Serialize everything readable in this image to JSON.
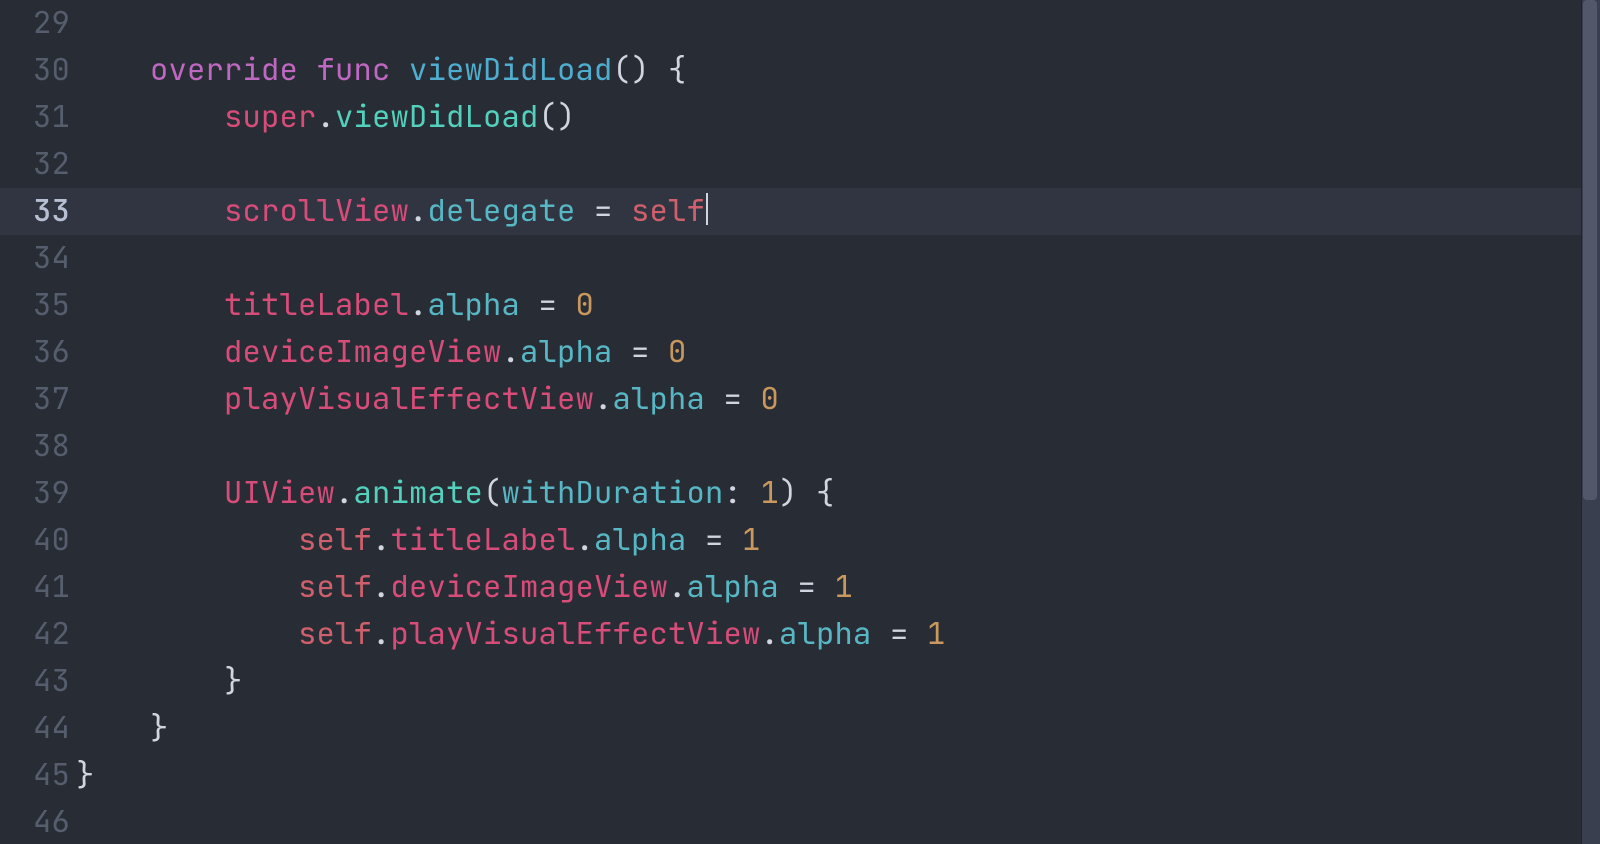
{
  "colors": {
    "bg": "#282c34",
    "keyword": "#bf68c1",
    "identifier": "#d84c7a",
    "func": "#4faecf",
    "call": "#53d1bd",
    "prop": "#58b7c4",
    "self": "#ce5f6c",
    "num": "#c8985e",
    "punct": "#d1d5e0",
    "gutter": "#565e6e",
    "gutter_active": "#b7c0d2",
    "active_line": "#303541",
    "scrollbar": "#52586a",
    "scrollbar_track": "#393f4e"
  },
  "editor": {
    "language": "swift",
    "active_line": 33,
    "cursor_line": 33,
    "first_visible_line": 29,
    "last_visible_line": 46,
    "line_numbers": [
      "29",
      "30",
      "31",
      "32",
      "33",
      "34",
      "35",
      "36",
      "37",
      "38",
      "39",
      "40",
      "41",
      "42",
      "43",
      "44",
      "45",
      "46"
    ],
    "lines": [
      {
        "n": 29,
        "indent": 0,
        "tokens": []
      },
      {
        "n": 30,
        "indent": 4,
        "tokens": [
          {
            "cls": "kw",
            "t": "override"
          },
          {
            "cls": "pt",
            "t": " "
          },
          {
            "cls": "kw",
            "t": "func"
          },
          {
            "cls": "pt",
            "t": " "
          },
          {
            "cls": "fn",
            "t": "viewDidLoad"
          },
          {
            "cls": "pt",
            "t": "() {"
          }
        ]
      },
      {
        "n": 31,
        "indent": 8,
        "tokens": [
          {
            "cls": "id",
            "t": "super"
          },
          {
            "cls": "pt",
            "t": "."
          },
          {
            "cls": "cl",
            "t": "viewDidLoad"
          },
          {
            "cls": "pt",
            "t": "()"
          }
        ]
      },
      {
        "n": 32,
        "indent": 0,
        "tokens": []
      },
      {
        "n": 33,
        "indent": 8,
        "tokens": [
          {
            "cls": "id",
            "t": "scrollView"
          },
          {
            "cls": "pt",
            "t": "."
          },
          {
            "cls": "pr",
            "t": "delegate"
          },
          {
            "cls": "pt",
            "t": " = "
          },
          {
            "cls": "sf",
            "t": "self"
          }
        ],
        "cursor_after": true
      },
      {
        "n": 34,
        "indent": 0,
        "tokens": []
      },
      {
        "n": 35,
        "indent": 8,
        "tokens": [
          {
            "cls": "id",
            "t": "titleLabel"
          },
          {
            "cls": "pt",
            "t": "."
          },
          {
            "cls": "pr",
            "t": "alpha"
          },
          {
            "cls": "pt",
            "t": " = "
          },
          {
            "cls": "nm",
            "t": "0"
          }
        ]
      },
      {
        "n": 36,
        "indent": 8,
        "tokens": [
          {
            "cls": "id",
            "t": "deviceImageView"
          },
          {
            "cls": "pt",
            "t": "."
          },
          {
            "cls": "pr",
            "t": "alpha"
          },
          {
            "cls": "pt",
            "t": " = "
          },
          {
            "cls": "nm",
            "t": "0"
          }
        ]
      },
      {
        "n": 37,
        "indent": 8,
        "tokens": [
          {
            "cls": "id",
            "t": "playVisualEffectView"
          },
          {
            "cls": "pt",
            "t": "."
          },
          {
            "cls": "pr",
            "t": "alpha"
          },
          {
            "cls": "pt",
            "t": " = "
          },
          {
            "cls": "nm",
            "t": "0"
          }
        ]
      },
      {
        "n": 38,
        "indent": 0,
        "tokens": []
      },
      {
        "n": 39,
        "indent": 8,
        "tokens": [
          {
            "cls": "id",
            "t": "UIView"
          },
          {
            "cls": "pt",
            "t": "."
          },
          {
            "cls": "cl",
            "t": "animate"
          },
          {
            "cls": "pt",
            "t": "("
          },
          {
            "cls": "pr",
            "t": "withDuration"
          },
          {
            "cls": "pt",
            "t": ": "
          },
          {
            "cls": "nm",
            "t": "1"
          },
          {
            "cls": "pt",
            "t": ") {"
          }
        ]
      },
      {
        "n": 40,
        "indent": 12,
        "tokens": [
          {
            "cls": "sf",
            "t": "self"
          },
          {
            "cls": "pt",
            "t": "."
          },
          {
            "cls": "id",
            "t": "titleLabel"
          },
          {
            "cls": "pt",
            "t": "."
          },
          {
            "cls": "pr",
            "t": "alpha"
          },
          {
            "cls": "pt",
            "t": " = "
          },
          {
            "cls": "nm",
            "t": "1"
          }
        ]
      },
      {
        "n": 41,
        "indent": 12,
        "tokens": [
          {
            "cls": "sf",
            "t": "self"
          },
          {
            "cls": "pt",
            "t": "."
          },
          {
            "cls": "id",
            "t": "deviceImageView"
          },
          {
            "cls": "pt",
            "t": "."
          },
          {
            "cls": "pr",
            "t": "alpha"
          },
          {
            "cls": "pt",
            "t": " = "
          },
          {
            "cls": "nm",
            "t": "1"
          }
        ]
      },
      {
        "n": 42,
        "indent": 12,
        "tokens": [
          {
            "cls": "sf",
            "t": "self"
          },
          {
            "cls": "pt",
            "t": "."
          },
          {
            "cls": "id",
            "t": "playVisualEffectView"
          },
          {
            "cls": "pt",
            "t": "."
          },
          {
            "cls": "pr",
            "t": "alpha"
          },
          {
            "cls": "pt",
            "t": " = "
          },
          {
            "cls": "nm",
            "t": "1"
          }
        ]
      },
      {
        "n": 43,
        "indent": 8,
        "tokens": [
          {
            "cls": "pt",
            "t": "}"
          }
        ]
      },
      {
        "n": 44,
        "indent": 4,
        "tokens": [
          {
            "cls": "pt",
            "t": "}"
          }
        ]
      },
      {
        "n": 45,
        "indent": 0,
        "tokens": [
          {
            "cls": "pt",
            "t": "}"
          }
        ]
      },
      {
        "n": 46,
        "indent": 0,
        "tokens": []
      }
    ]
  }
}
